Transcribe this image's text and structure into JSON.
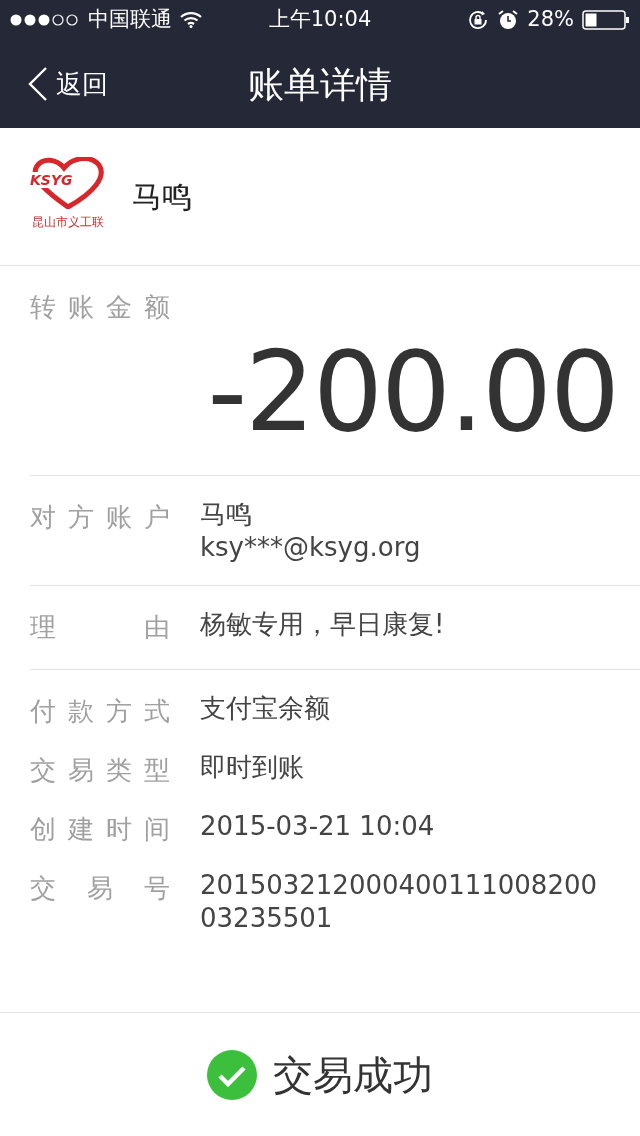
{
  "status_bar": {
    "carrier": "中国联通",
    "time": "上午10:04",
    "battery": "28%"
  },
  "nav": {
    "back": "返回",
    "title": "账单详情"
  },
  "payee": {
    "logo_brand": "KSYG",
    "logo_caption": "昆山市义工联",
    "name": "马鸣"
  },
  "amount": {
    "label": "转账金额",
    "value": "-200.00"
  },
  "sections": [
    {
      "rows": [
        {
          "label": "对方账户",
          "lines": [
            "马鸣",
            "ksy***@ksyg.org"
          ]
        }
      ]
    },
    {
      "rows": [
        {
          "label": "理 由",
          "lines": [
            "杨敏专用，早日康复!"
          ]
        }
      ]
    },
    {
      "rows": [
        {
          "label": "付款方式",
          "lines": [
            "支付宝余额"
          ]
        },
        {
          "label": "交易类型",
          "lines": [
            "即时到账"
          ]
        },
        {
          "label": "创建时间",
          "lines": [
            "2015-03-21 10:04"
          ]
        },
        {
          "label": "交 易 号",
          "lines": [
            "201503212000400111008200",
            "03235501"
          ]
        }
      ]
    }
  ],
  "result": {
    "text": "交易成功"
  }
}
